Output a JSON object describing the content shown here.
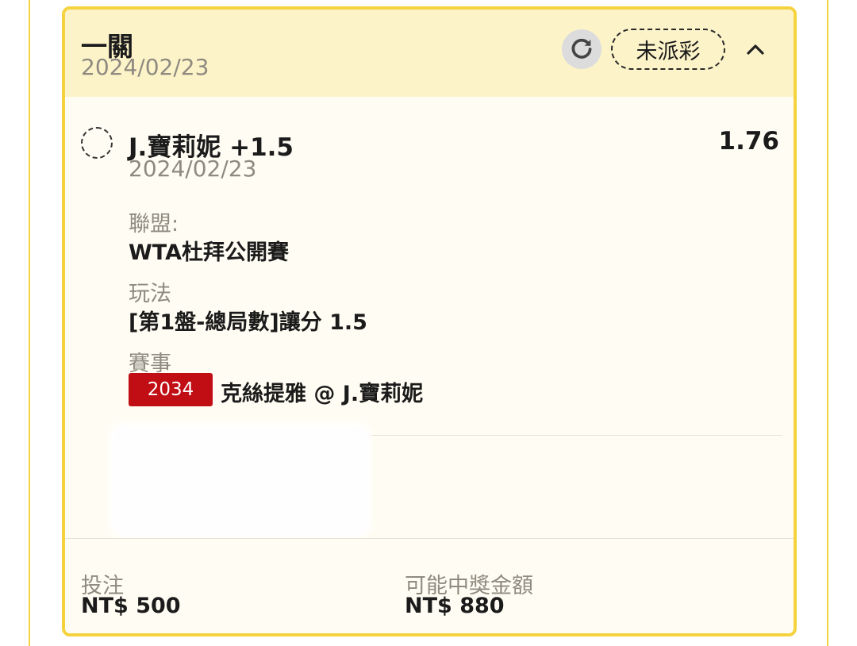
{
  "header": {
    "title": "一關",
    "date": "2024/02/23",
    "status": "未派彩",
    "refresh_icon": "refresh-icon",
    "collapse_icon": "chevron-up-icon"
  },
  "selection": {
    "name": "J.寶莉妮 +1.5",
    "date": "2024/02/23",
    "odds": "1.76"
  },
  "details": {
    "league_label": "聯盟:",
    "league_value": "WTA杜拜公開賽",
    "market_label": "玩法",
    "market_value": "[第1盤-總局數]讓分 1.5",
    "event_label": "賽事",
    "event_code": "2034",
    "event_name": "克絲提雅 @ J.寶莉妮"
  },
  "footer": {
    "stake_label": "投注",
    "stake_value": "NT$ 500",
    "payout_label": "可能中獎金額",
    "payout_value": "NT$ 880"
  },
  "colors": {
    "accent": "#f4d33f",
    "header_bg": "#fdf3c8",
    "card_bg": "#fffdf3",
    "badge_red": "#c10e14",
    "muted_text": "#8e8a80"
  }
}
